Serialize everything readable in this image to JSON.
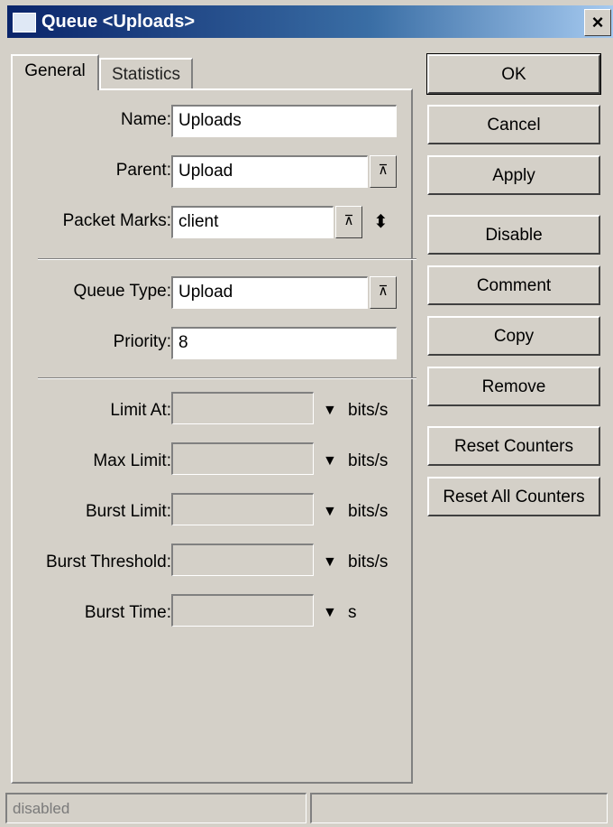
{
  "window": {
    "title": "Queue <Uploads>",
    "close_glyph": "×"
  },
  "tabs": [
    {
      "label": "General",
      "active": true
    },
    {
      "label": "Statistics",
      "active": false
    }
  ],
  "form": {
    "name": {
      "label": "Name:",
      "value": "Uploads"
    },
    "parent": {
      "label": "Parent:",
      "value": "Upload"
    },
    "packet_marks": {
      "label": "Packet Marks:",
      "value": "client"
    },
    "queue_type": {
      "label": "Queue Type:",
      "value": "Upload"
    },
    "priority": {
      "label": "Priority:",
      "value": "8"
    },
    "limit_at": {
      "label": "Limit At:",
      "value": "",
      "unit": "bits/s"
    },
    "max_limit": {
      "label": "Max Limit:",
      "value": "",
      "unit": "bits/s"
    },
    "burst_limit": {
      "label": "Burst Limit:",
      "value": "",
      "unit": "bits/s"
    },
    "burst_threshold": {
      "label": "Burst Threshold:",
      "value": "",
      "unit": "bits/s"
    },
    "burst_time": {
      "label": "Burst Time:",
      "value": "",
      "unit": "s"
    }
  },
  "glyphs": {
    "dropdown": "⊼",
    "arrow_down": "▼",
    "updown": "⬍"
  },
  "buttons": {
    "ok": "OK",
    "cancel": "Cancel",
    "apply": "Apply",
    "disable": "Disable",
    "comment": "Comment",
    "copy": "Copy",
    "remove": "Remove",
    "reset_counters": "Reset Counters",
    "reset_all_counters": "Reset All Counters"
  },
  "status": {
    "left": "disabled",
    "right": ""
  },
  "colors": {
    "titlebar_start": "#0a246a",
    "titlebar_end": "#a6caf0",
    "face": "#d4d0c8"
  }
}
